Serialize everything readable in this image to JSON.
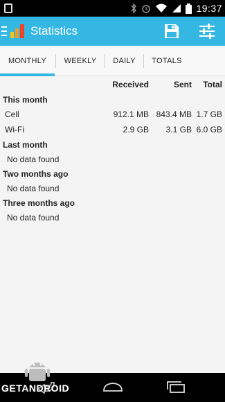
{
  "status_bar": {
    "time": "19:37",
    "icons": [
      "image-icon",
      "bluetooth-icon",
      "alarm-icon",
      "wifi-icon",
      "signal-icon",
      "battery-icon"
    ]
  },
  "app": {
    "title": "Statistics",
    "accent_color": "#35b7e3"
  },
  "tabs": [
    {
      "label": "MONTHLY",
      "active": true
    },
    {
      "label": "WEEKLY",
      "active": false
    },
    {
      "label": "DAILY",
      "active": false
    },
    {
      "label": "TOTALS",
      "active": false
    }
  ],
  "table": {
    "headers": {
      "received": "Received",
      "sent": "Sent",
      "total": "Total"
    },
    "sections": [
      {
        "title": "This month",
        "rows": [
          {
            "label": "Cell",
            "received": "912.1 MB",
            "sent": "843.4 MB",
            "total": "1.7 GB"
          },
          {
            "label": "Wi-Fi",
            "received": "2.9 GB",
            "sent": "3.1 GB",
            "total": "6.0 GB"
          }
        ]
      },
      {
        "title": "Last month",
        "empty": "No data found"
      },
      {
        "title": "Two months ago",
        "empty": "No data found"
      },
      {
        "title": "Three months ago",
        "empty": "No data found"
      }
    ]
  },
  "watermark": {
    "text": "GETANDROID"
  }
}
